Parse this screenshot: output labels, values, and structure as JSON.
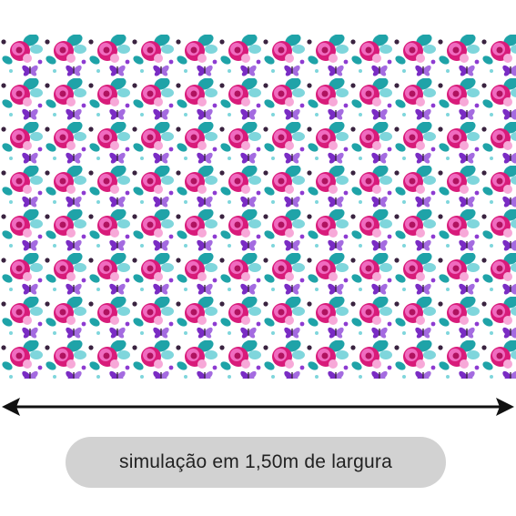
{
  "pattern": {
    "motifs": [
      "butterfly-icon",
      "rose-icon",
      "leaf-icon"
    ],
    "colors": {
      "background": "#ffffff",
      "magenta": "#d81b7a",
      "pink": "#f06bc0",
      "purple": "#7a2cc4",
      "violet": "#a46be0",
      "teal": "#1fa3a8",
      "aqua": "#7fd6dc",
      "dark": "#3a2340"
    }
  },
  "width_indicator": {
    "label": "simulação em 1,50m de largura",
    "arrow_color": "#111111",
    "pill_color": "#d2d2d2"
  }
}
